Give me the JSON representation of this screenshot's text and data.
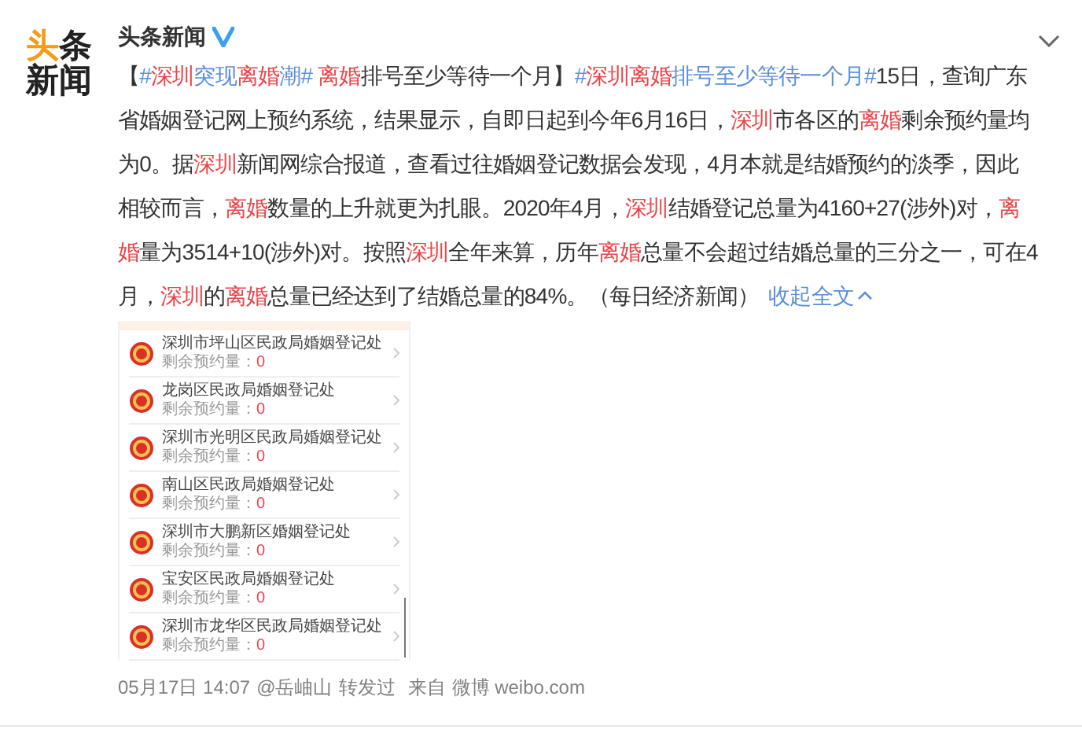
{
  "logo": {
    "lines": [
      "头条",
      "新闻"
    ]
  },
  "account": {
    "name": "头条新闻",
    "verified": true
  },
  "post": {
    "parts": [
      {
        "kind": "text",
        "text": "【"
      },
      {
        "kind": "hashtag",
        "pieces": [
          {
            "text": "#",
            "highlight": false
          },
          {
            "text": "深圳",
            "highlight": true
          },
          {
            "text": "突现",
            "highlight": false
          },
          {
            "text": "离婚",
            "highlight": true
          },
          {
            "text": "潮# ",
            "highlight": false
          }
        ]
      },
      {
        "kind": "keyword",
        "text": "离婚"
      },
      {
        "kind": "text",
        "text": "排号至少等待一个月】"
      },
      {
        "kind": "hashtag",
        "pieces": [
          {
            "text": "#",
            "highlight": false
          },
          {
            "text": "深圳离婚",
            "highlight": true
          },
          {
            "text": "排号至少等待一个月#",
            "highlight": false
          }
        ]
      },
      {
        "kind": "text",
        "text": "15日，查询广东省婚姻登记网上预约系统，结果显示，自即日起到今年6月16日，"
      },
      {
        "kind": "keyword",
        "text": "深圳"
      },
      {
        "kind": "text",
        "text": "市各区的"
      },
      {
        "kind": "keyword",
        "text": "离婚"
      },
      {
        "kind": "text",
        "text": "剩余预约量均为0。据"
      },
      {
        "kind": "keyword",
        "text": "深圳"
      },
      {
        "kind": "text",
        "text": "新闻网综合报道，查看过往婚姻登记数据会发现，4月本就是结婚预约的淡季，因此相较而言，"
      },
      {
        "kind": "keyword",
        "text": "离婚"
      },
      {
        "kind": "text",
        "text": "数量的上升就更为扎眼。2020年4月，"
      },
      {
        "kind": "keyword",
        "text": "深圳"
      },
      {
        "kind": "text",
        "text": "结婚登记总量为4160+27(涉外)对，"
      },
      {
        "kind": "keyword",
        "text": "离婚"
      },
      {
        "kind": "text",
        "text": "量为3514+10(涉外)对。按照"
      },
      {
        "kind": "keyword",
        "text": "深圳"
      },
      {
        "kind": "text",
        "text": "全年来算，历年"
      },
      {
        "kind": "keyword",
        "text": "离婚"
      },
      {
        "kind": "text",
        "text": "总量不会超过结婚总量的三分之一，可在4月，"
      },
      {
        "kind": "keyword",
        "text": "深圳"
      },
      {
        "kind": "text",
        "text": "的"
      },
      {
        "kind": "keyword",
        "text": "离婚"
      },
      {
        "kind": "text",
        "text": "总量已经达到了结婚总量的84%。（每日经济新闻）"
      }
    ],
    "collapse_link": "收起全文"
  },
  "image_rows": [
    {
      "title": "深圳市坪山区民政局婚姻登记处",
      "label": "剩余预约量：",
      "value": "0"
    },
    {
      "title": "龙岗区民政局婚姻登记处",
      "label": "剩余预约量：",
      "value": "0"
    },
    {
      "title": "深圳市光明区民政局婚姻登记处",
      "label": "剩余预约量：",
      "value": "0"
    },
    {
      "title": "南山区民政局婚姻登记处",
      "label": "剩余预约量：",
      "value": "0"
    },
    {
      "title": "深圳市大鹏新区婚姻登记处",
      "label": "剩余预约量：",
      "value": "0"
    },
    {
      "title": "宝安区民政局婚姻登记处",
      "label": "剩余预约量：",
      "value": "0"
    },
    {
      "title": "深圳市龙华区民政局婚姻登记处",
      "label": "剩余预约量：",
      "value": "0"
    }
  ],
  "meta": {
    "time": "05月17日 14:07",
    "user": "@岳岫山",
    "action": "转发过",
    "source_prefix": "来自",
    "source": "微博 weibo.com"
  }
}
